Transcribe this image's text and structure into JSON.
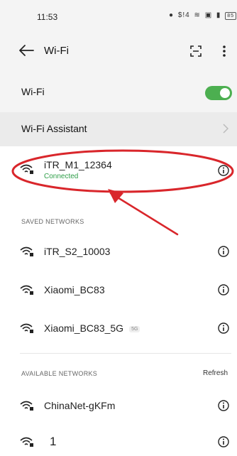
{
  "status_bar": {
    "time": "11:53",
    "icons": [
      "alarm-icon",
      "signal-icon",
      "wifi-icon",
      "nfc-icon",
      "signal-icon",
      "battery-icon"
    ],
    "signal_text": "$!4",
    "battery": "85"
  },
  "app_bar": {
    "title": "Wi-Fi"
  },
  "wifi_toggle": {
    "label": "Wi-Fi",
    "enabled": true,
    "color": "#4caf50"
  },
  "assistant": {
    "label": "Wi-Fi Assistant"
  },
  "connected_network": {
    "name": "iTR_M1_12364",
    "status": "Connected",
    "status_color": "#2e9e48"
  },
  "saved_networks": {
    "header": "SAVED NETWORKS",
    "items": [
      {
        "name": "iTR_S2_10003",
        "badge": ""
      },
      {
        "name": "Xiaomi_BC83",
        "badge": ""
      },
      {
        "name": "Xiaomi_BC83_5G",
        "badge": "5G"
      }
    ]
  },
  "available_networks": {
    "header": "AVAILABLE NETWORKS",
    "refresh": "Refresh",
    "items": [
      {
        "name": "ChinaNet-gKFm"
      },
      {
        "name": "1"
      }
    ]
  },
  "annotation": {
    "color": "#d9262b"
  }
}
